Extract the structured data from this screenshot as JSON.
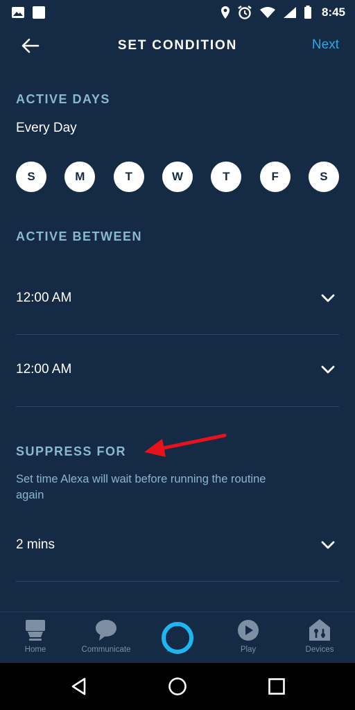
{
  "status_bar": {
    "time": "8:45"
  },
  "header": {
    "title": "SET CONDITION",
    "next_label": "Next"
  },
  "active_days": {
    "title": "ACTIVE DAYS",
    "summary": "Every Day",
    "days": [
      "S",
      "M",
      "T",
      "W",
      "T",
      "F",
      "S"
    ]
  },
  "active_between": {
    "title": "ACTIVE BETWEEN",
    "start_time": "12:00 AM",
    "end_time": "12:00 AM"
  },
  "suppress_for": {
    "title": "SUPPRESS FOR",
    "description": "Set time Alexa will wait before running the routine again",
    "value": "2 mins"
  },
  "bottom_nav": {
    "items": [
      {
        "label": "Home"
      },
      {
        "label": "Communicate"
      },
      {
        "label": ""
      },
      {
        "label": "Play"
      },
      {
        "label": "Devices"
      }
    ]
  },
  "colors": {
    "background": "#152a44",
    "accent": "#2aa8e6",
    "section_title": "#8ab8cf",
    "annotation_arrow": "#e8121b"
  }
}
